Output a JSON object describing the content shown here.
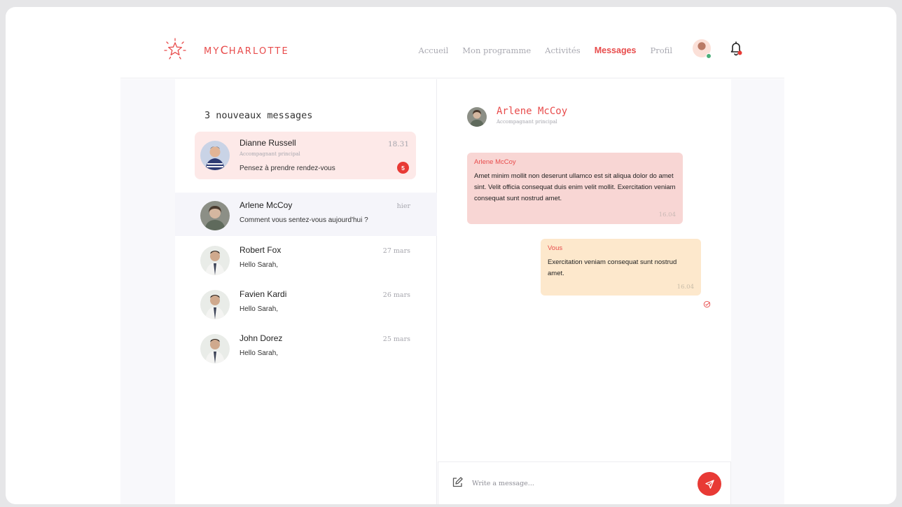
{
  "header": {
    "brand_prefix": "MY",
    "brand_big": "C",
    "brand_rest": "HARLOTTE",
    "nav": [
      {
        "label": "Accueil"
      },
      {
        "label": "Mon programme"
      },
      {
        "label": "Activités"
      },
      {
        "label": "Messages",
        "active": true
      },
      {
        "label": "Profil"
      }
    ],
    "icons": {
      "logo": "star-logo-icon",
      "notifications": "bell-icon"
    }
  },
  "inbox": {
    "title": "3 nouveaux messages",
    "conversations": [
      {
        "name": "Dianne Russell",
        "role": "Accompagnant principal",
        "preview": "Pensez à prendre rendez-vous",
        "time": "18.31",
        "unread_count": "5"
      },
      {
        "name": "Arlene McCoy",
        "preview": "Comment vous sentez-vous aujourd'hui ?",
        "time": "hier"
      },
      {
        "name": "Robert Fox",
        "preview": "Hello Sarah,",
        "time": "27 mars"
      },
      {
        "name": "Favien Kardi",
        "preview": "Hello Sarah,",
        "time": "26 mars"
      },
      {
        "name": "John Dorez",
        "preview": "Hello Sarah,",
        "time": "25 mars"
      }
    ]
  },
  "chat": {
    "contact_name": "Arlene McCoy",
    "contact_role": "Accompagnant principal",
    "messages": [
      {
        "sender": "Arlene McCoy",
        "text": "Amet minim mollit non deserunt ullamco est sit aliqua dolor do amet sint. Velit officia consequat duis enim velit mollit. Exercitation veniam consequat sunt nostrud amet.",
        "time": "16.04"
      },
      {
        "sender": "Vous",
        "text": "Exercitation veniam consequat sunt nostrud amet.",
        "time": "16.04"
      }
    ],
    "composer_placeholder": "Write a message...",
    "colors": {
      "accent": "#e84c4c",
      "incoming_bubble": "#f8d6d4",
      "outgoing_bubble": "#fde8cc",
      "badge": "#e83a35"
    }
  }
}
